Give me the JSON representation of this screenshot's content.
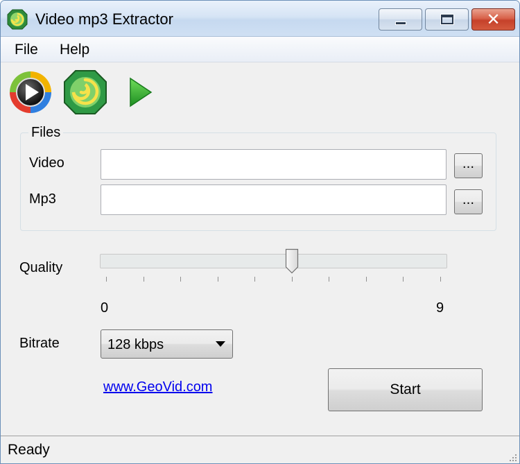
{
  "window": {
    "title": "Video mp3 Extractor"
  },
  "titlebar_buttons": {
    "minimize": "minimize",
    "maximize": "maximize",
    "close": "✕"
  },
  "menu": {
    "items": [
      {
        "label": "File"
      },
      {
        "label": "Help"
      }
    ]
  },
  "toolbar": {
    "icons": [
      "media-player-icon",
      "geovid-logo-icon",
      "play-icon"
    ]
  },
  "files_group": {
    "legend": "Files",
    "video": {
      "label": "Video",
      "value": "",
      "browse_label": "..."
    },
    "mp3": {
      "label": "Mp3",
      "value": "",
      "browse_label": "..."
    }
  },
  "quality": {
    "label": "Quality",
    "min_label": "0",
    "max_label": "9",
    "min": 0,
    "max": 9,
    "value": 5
  },
  "bitrate": {
    "label": "Bitrate",
    "selected": "128 kbps"
  },
  "link": {
    "text": "www.GeoVid.com"
  },
  "start_button": {
    "label": "Start"
  },
  "status": {
    "text": "Ready"
  },
  "colors": {
    "title_bar": "#d6e4f5",
    "close_button": "#c6412a",
    "link": "#0000ee",
    "play_green": "#2fa82f"
  }
}
